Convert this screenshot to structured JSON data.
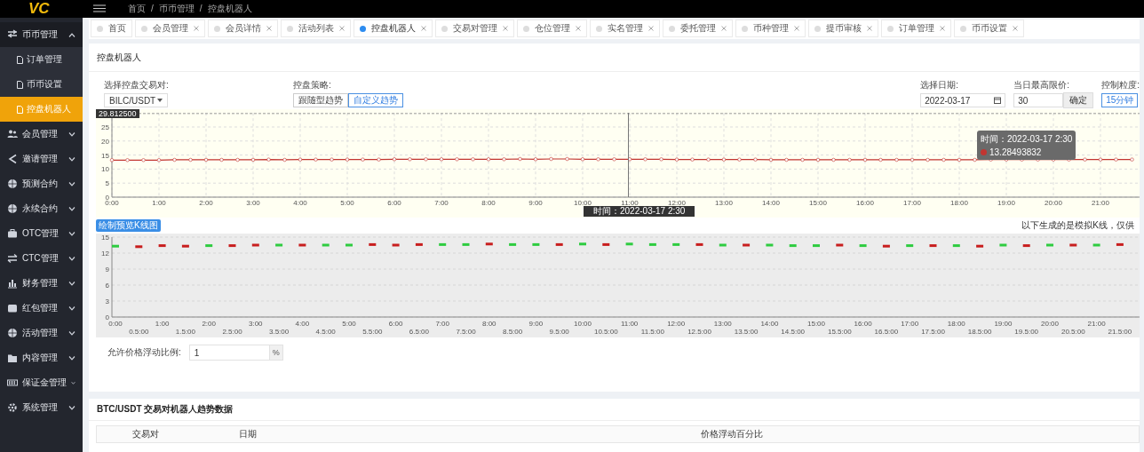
{
  "topbar": {
    "logo": "VC",
    "breadcrumb": [
      "首页",
      "币币管理",
      "控盘机器人"
    ],
    "separator": "/"
  },
  "sidebar": {
    "groups": [
      {
        "label": "币币管理",
        "expanded": true,
        "children": [
          {
            "label": "订单管理",
            "selected": false
          },
          {
            "label": "币币设置",
            "selected": false
          },
          {
            "label": "控盘机器人",
            "selected": true
          }
        ]
      },
      {
        "label": "会员管理",
        "expanded": false
      },
      {
        "label": "邀请管理",
        "expanded": false
      },
      {
        "label": "预测合约",
        "expanded": false
      },
      {
        "label": "永续合约",
        "expanded": false
      },
      {
        "label": "OTC管理",
        "expanded": false
      },
      {
        "label": "CTC管理",
        "expanded": false
      },
      {
        "label": "财务管理",
        "expanded": false
      },
      {
        "label": "红包管理",
        "expanded": false
      },
      {
        "label": "活动管理",
        "expanded": false
      },
      {
        "label": "内容管理",
        "expanded": false
      },
      {
        "label": "保证金管理",
        "expanded": false
      },
      {
        "label": "系统管理",
        "expanded": false
      }
    ]
  },
  "tabs": [
    {
      "label": "首页",
      "selected": false,
      "closable": false
    },
    {
      "label": "会员管理",
      "selected": false,
      "closable": true
    },
    {
      "label": "会员详情",
      "selected": false,
      "closable": true
    },
    {
      "label": "活动列表",
      "selected": false,
      "closable": true
    },
    {
      "label": "控盘机器人",
      "selected": true,
      "closable": true
    },
    {
      "label": "交易对管理",
      "selected": false,
      "closable": true
    },
    {
      "label": "仓位管理",
      "selected": false,
      "closable": true
    },
    {
      "label": "实名管理",
      "selected": false,
      "closable": true
    },
    {
      "label": "委托管理",
      "selected": false,
      "closable": true
    },
    {
      "label": "币种管理",
      "selected": false,
      "closable": true
    },
    {
      "label": "提币审核",
      "selected": false,
      "closable": true
    },
    {
      "label": "订单管理",
      "selected": false,
      "closable": true
    },
    {
      "label": "币币设置",
      "selected": false,
      "closable": true
    }
  ],
  "robot_card": {
    "title": "控盘机器人",
    "pair": {
      "label": "选择控盘交易对:",
      "value": "BILC/USDT"
    },
    "strategy": {
      "label": "控盘策略:",
      "options": [
        {
          "label": "跟随型趋势",
          "selected": false
        },
        {
          "label": "自定义趋势",
          "selected": true
        }
      ]
    },
    "date": {
      "label": "选择日期:",
      "value": "2022-03-17"
    },
    "max_price": {
      "label": "当日最高限价:",
      "value": "30",
      "button": "确定"
    },
    "granularity": {
      "label": "控制粒度:",
      "value": "15分钟"
    },
    "trend_chart": {
      "axis_pointer_label": "29.812500",
      "crosshair_label": "时间：2022-03-17 2:30",
      "tooltip": {
        "time": "时间：2022-03-17 2:30",
        "value": "13.28493832"
      },
      "chart_data": {
        "type": "line",
        "grid": true,
        "ylim": [
          0,
          30
        ],
        "yticks": [
          0,
          5,
          10,
          15,
          20,
          25
        ],
        "xlim": [
          0,
          21.8
        ],
        "xticks": [
          {
            "value": 0,
            "label": "0:00"
          },
          {
            "value": 1,
            "label": "1:00"
          },
          {
            "value": 2,
            "label": "2:00"
          },
          {
            "value": 3,
            "label": "3:00"
          },
          {
            "value": 4,
            "label": "4:00"
          },
          {
            "value": 5,
            "label": "5:00"
          },
          {
            "value": 6,
            "label": "6:00"
          },
          {
            "value": 7,
            "label": "7:00"
          },
          {
            "value": 8,
            "label": "8:00"
          },
          {
            "value": 9,
            "label": "9:00"
          },
          {
            "value": 10,
            "label": "10:00"
          },
          {
            "value": 11,
            "label": "11:00"
          },
          {
            "value": 12,
            "label": "12:00"
          },
          {
            "value": 13,
            "label": "13:00"
          },
          {
            "value": 14,
            "label": "14:00"
          },
          {
            "value": 15,
            "label": "15:00"
          },
          {
            "value": 16,
            "label": "16:00"
          },
          {
            "value": 17,
            "label": "17:00"
          },
          {
            "value": 18,
            "label": "18:00"
          },
          {
            "value": 19,
            "label": "19:00"
          },
          {
            "value": 20,
            "label": "20:00"
          },
          {
            "value": 21,
            "label": "21:00"
          }
        ],
        "x": [
          0,
          0.33,
          0.67,
          1,
          1.33,
          1.67,
          2,
          2.33,
          2.67,
          3,
          3.33,
          3.67,
          4,
          4.33,
          4.67,
          5,
          5.33,
          5.67,
          6,
          6.33,
          6.67,
          7,
          7.33,
          7.67,
          8,
          8.33,
          8.67,
          9,
          9.33,
          9.67,
          10,
          10.33,
          10.67,
          11,
          11.33,
          11.67,
          12,
          12.33,
          12.67,
          13,
          13.33,
          13.67,
          14,
          14.33,
          14.67,
          15,
          15.33,
          15.67,
          16,
          16.33,
          16.67,
          17,
          17.33,
          17.67,
          18,
          18.33,
          18.67,
          19,
          19.33,
          19.67,
          20,
          20.33,
          20.67,
          21,
          21.33,
          21.67
        ],
        "series": [
          {
            "color": "#c23531",
            "marker": "circle",
            "values": [
              13.2,
              13.2,
              13.2,
              13.2,
              13.3,
              13.3,
              13.3,
              13.3,
              13.3,
              13.3,
              13.4,
              13.3,
              13.4,
              13.4,
              13.4,
              13.4,
              13.4,
              13.4,
              13.5,
              13.5,
              13.5,
              13.5,
              13.5,
              13.5,
              13.5,
              13.5,
              13.6,
              13.5,
              13.6,
              13.6,
              13.5,
              13.5,
              13.5,
              13.5,
              13.5,
              13.5,
              13.4,
              13.4,
              13.4,
              13.4,
              13.4,
              13.4,
              13.3,
              13.3,
              13.3,
              13.3,
              13.3,
              13.3,
              13.3,
              13.3,
              13.3,
              13.3,
              13.3,
              13.3,
              13.3,
              13.3,
              13.4,
              13.4,
              13.4,
              13.4,
              13.4,
              13.4,
              13.4,
              13.4,
              13.4,
              13.4
            ]
          }
        ]
      }
    },
    "preview_button": "绘制预览K线图",
    "preview_note": "以下生成的是模拟K线，仅供",
    "kline_chart": {
      "chart_data": {
        "type": "scatter",
        "grid": true,
        "ylim": [
          0,
          15
        ],
        "yticks": [
          0,
          3,
          6,
          9,
          12,
          15
        ],
        "categories": [
          "0:00",
          "0.5:00",
          "1:00",
          "1.5:00",
          "2:00",
          "2.5:00",
          "3:00",
          "3.5:00",
          "4:00",
          "4.5:00",
          "5:00",
          "5.5:00",
          "6:00",
          "6.5:00",
          "7:00",
          "7.5:00",
          "8:00",
          "8.5:00",
          "9:00",
          "9.5:00",
          "10:00",
          "10.5:00",
          "11:00",
          "11.5:00",
          "12:00",
          "12.5:00",
          "13:00",
          "13.5:00",
          "14:00",
          "14.5:00",
          "15:00",
          "15.5:00",
          "16:00",
          "16.5:00",
          "17:00",
          "17.5:00",
          "18:00",
          "18.5:00",
          "19:00",
          "19.5:00",
          "20:00",
          "20.5:00",
          "21:00",
          "21.5:00"
        ],
        "series": [
          {
            "color": "#2ecc40",
            "values": [
              13.3,
              null,
              null,
              null,
              13.4,
              null,
              null,
              13.5,
              null,
              13.5,
              13.5,
              null,
              null,
              null,
              13.6,
              13.6,
              null,
              13.6,
              13.6,
              null,
              13.7,
              null,
              13.7,
              13.6,
              13.6,
              null,
              13.5,
              null,
              13.5,
              13.4,
              13.4,
              null,
              13.4,
              null,
              13.4,
              null,
              13.4,
              null,
              13.5,
              null,
              13.5,
              null,
              13.5,
              null
            ]
          },
          {
            "color": "#c81e1e",
            "values": [
              null,
              13.2,
              13.4,
              13.3,
              null,
              13.4,
              13.5,
              null,
              13.5,
              null,
              null,
              13.6,
              13.5,
              13.6,
              null,
              null,
              13.7,
              null,
              null,
              13.6,
              null,
              13.6,
              null,
              null,
              null,
              13.6,
              null,
              13.5,
              null,
              null,
              null,
              13.5,
              null,
              13.3,
              null,
              13.4,
              null,
              13.3,
              null,
              13.4,
              null,
              13.5,
              null,
              13.6
            ]
          }
        ]
      }
    },
    "float_ratio": {
      "label": "允许价格浮动比例:",
      "value": "1",
      "unit": "%"
    }
  },
  "trend_card": {
    "title": "BTC/USDT 交易对机器人趋势数据",
    "columns": [
      "交易对",
      "日期",
      "价格浮动百分比"
    ]
  }
}
